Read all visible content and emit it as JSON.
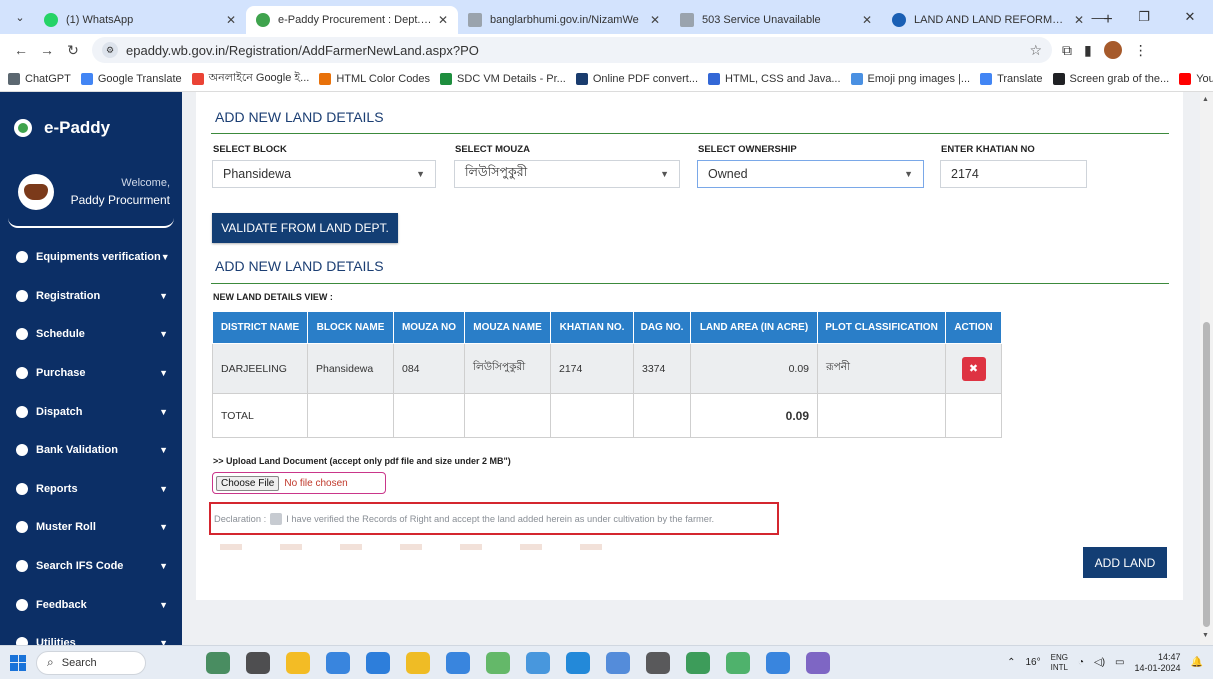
{
  "browser": {
    "tabs": [
      {
        "title": "(1) WhatsApp",
        "color": "#25d366",
        "active": false
      },
      {
        "title": "e-Paddy Procurement : Dept. of",
        "color": "#3fa34d",
        "active": true
      },
      {
        "title": "banglarbhumi.gov.in/NizamWe",
        "color": "#9aa3ad",
        "active": false
      },
      {
        "title": "503 Service Unavailable",
        "color": "#9aa3ad",
        "active": false
      },
      {
        "title": "LAND AND LAND REFORMS AI",
        "color": "#1a5fb4",
        "active": false
      }
    ],
    "url": "epaddy.wb.gov.in/Registration/AddFarmerNewLand.aspx?PO",
    "bookmarks": [
      {
        "label": "ChatGPT",
        "color": "#5b6770"
      },
      {
        "label": "Google Translate",
        "color": "#4285f4"
      },
      {
        "label": "অনলাইনে Google ই...",
        "color": "#ea4335"
      },
      {
        "label": "HTML Color Codes",
        "color": "#e8710a"
      },
      {
        "label": "SDC VM Details - Pr...",
        "color": "#1e8e3e"
      },
      {
        "label": "Online PDF convert...",
        "color": "#1a3c6e"
      },
      {
        "label": "HTML, CSS and Java...",
        "color": "#3367d6"
      },
      {
        "label": "Emoji png images |...",
        "color": "#4a90e2"
      },
      {
        "label": "Translate",
        "color": "#4285f4"
      },
      {
        "label": "Screen grab of the...",
        "color": "#202124"
      },
      {
        "label": "YouTube",
        "color": "#ff0000"
      }
    ]
  },
  "sidebar": {
    "brand": "e-Paddy",
    "welcome": "Welcome,",
    "user": "Paddy Procurment",
    "items": [
      {
        "label": "Equipments verification"
      },
      {
        "label": "Registration"
      },
      {
        "label": "Schedule"
      },
      {
        "label": "Purchase"
      },
      {
        "label": "Dispatch"
      },
      {
        "label": "Bank Validation"
      },
      {
        "label": "Reports"
      },
      {
        "label": "Muster Roll"
      },
      {
        "label": "Search IFS Code"
      },
      {
        "label": "Feedback"
      },
      {
        "label": "Utilities"
      }
    ]
  },
  "main": {
    "section_title": "ADD NEW LAND DETAILS",
    "section_title2": "ADD NEW LAND DETAILS",
    "block_label": "SELECT BLOCK",
    "block_value": "Phansidewa",
    "mouza_label": "SELECT MOUZA",
    "mouza_value": "লিউসিপুকুরী",
    "ownership_label": "SELECT OWNERSHIP",
    "ownership_value": "Owned",
    "khatian_label": "ENTER KHATIAN NO",
    "khatian_value": "2174",
    "validate_button": "VALIDATE FROM LAND DEPT.",
    "table_label": "NEW LAND DETAILS VIEW :",
    "table": {
      "headers": [
        "DISTRICT NAME",
        "BLOCK NAME",
        "MOUZA NO",
        "MOUZA NAME",
        "KHATIAN NO.",
        "DAG NO.",
        "LAND AREA (IN ACRE)",
        "PLOT CLASSIFICATION",
        "ACTION"
      ],
      "row": {
        "district": "DARJEELING",
        "block": "Phansidewa",
        "mouza_no": "084",
        "mouza_name": "লিউসিপুকুরী",
        "khatian": "2174",
        "dag": "3374",
        "area": "0.09",
        "classification": "রূপনী",
        "action": "✖"
      },
      "total_label": "TOTAL",
      "total_area": "0.09"
    },
    "upload_label": ">> Upload Land Document (accept only pdf file and size under 2 MB\")",
    "file_button": "Choose File",
    "file_status": "No file chosen",
    "declaration_prefix": "Declaration :",
    "declaration_text": "I have verified the Records of Right and accept the land added herein as under cultivation by the farmer.",
    "add_button": "ADD LAND"
  },
  "taskbar": {
    "search": "Search",
    "temp": "16°",
    "lang1": "ENG",
    "lang2": "INTL",
    "time": "14:47",
    "date": "14-01-2024",
    "apps": [
      "#2d7d46",
      "#333",
      "#f4b400",
      "#1a73d9",
      "#0c6bd6",
      "#f0b400",
      "#1a73d9",
      "#4caf50",
      "#2b88d8",
      "#0078d4",
      "#3a7bd5",
      "#404040",
      "#1e8e3e",
      "#34a853",
      "#1a73d9",
      "#6b4fbb"
    ]
  }
}
